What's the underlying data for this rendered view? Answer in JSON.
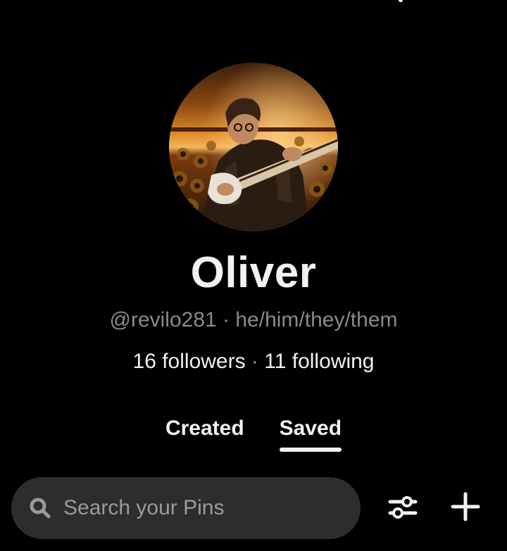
{
  "profile": {
    "name": "Oliver",
    "handle": "@revilo281",
    "pronouns": "he/him/they/them",
    "separator": " · ",
    "followers": "16 followers",
    "following": "11 following"
  },
  "tabs": [
    {
      "label": "Created",
      "active": false
    },
    {
      "label": "Saved",
      "active": true
    }
  ],
  "search": {
    "placeholder": "Search your Pins",
    "value": ""
  },
  "icons": {
    "search": "search-icon",
    "filter": "sliders-icon",
    "add": "plus-icon"
  },
  "colors": {
    "background": "#000000",
    "text": "#f2f2f2",
    "muted": "#8a8a8a",
    "search_bg": "#2d2d2d"
  }
}
